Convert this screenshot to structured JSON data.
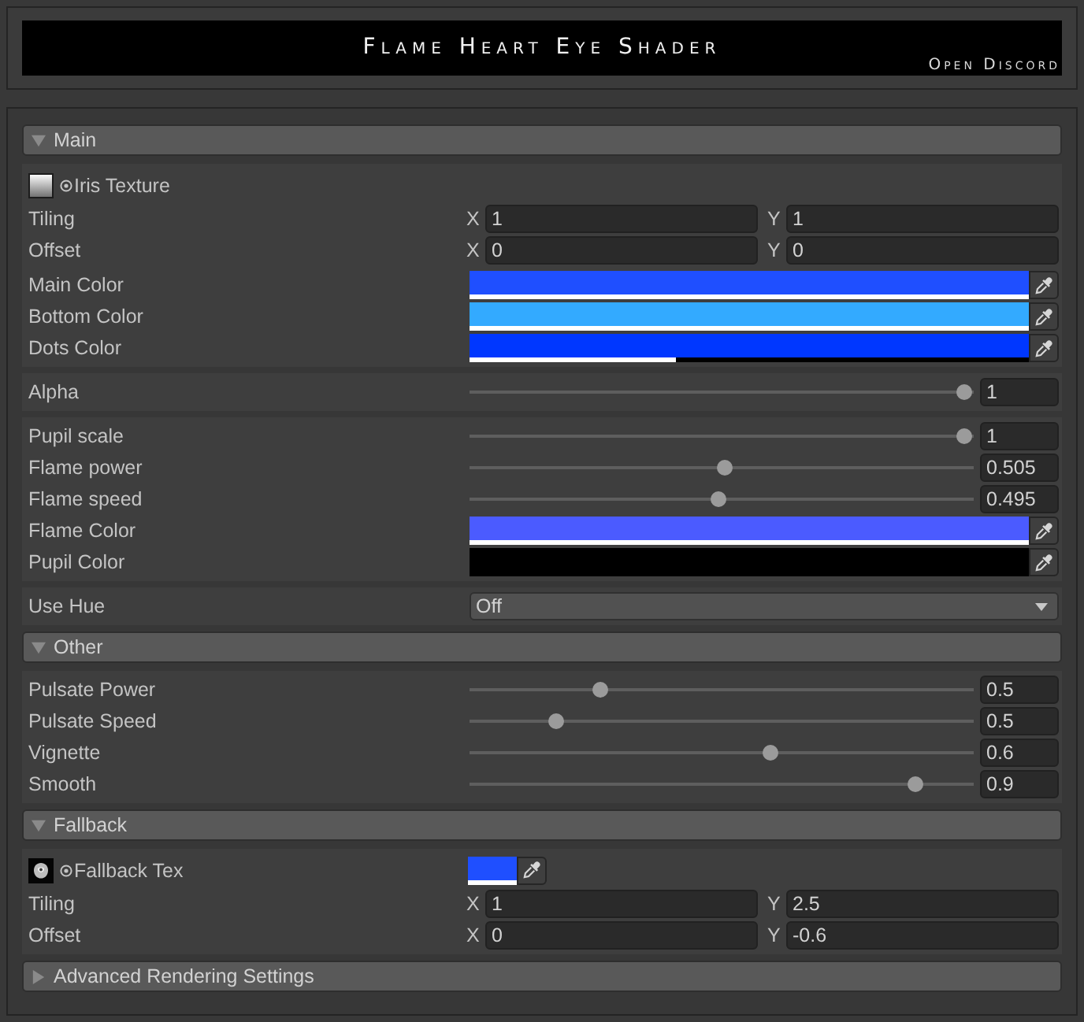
{
  "header": {
    "title": "Flame Heart Eye Shader",
    "link": "Open Discord"
  },
  "sections": [
    {
      "title": "Main",
      "expanded": true,
      "groups": [
        {
          "rows": [
            {
              "kind": "texture",
              "label": "Iris Texture",
              "thumbnail": {
                "kind": "gradient"
              }
            },
            {
              "kind": "vector",
              "label": "Tiling",
              "fields": [
                {
                  "axis": "X",
                  "value": "1"
                },
                {
                  "axis": "Y",
                  "value": "1"
                }
              ]
            },
            {
              "kind": "vector",
              "label": "Offset",
              "fields": [
                {
                  "axis": "X",
                  "value": "0"
                },
                {
                  "axis": "Y",
                  "value": "0"
                }
              ]
            },
            {
              "kind": "color",
              "label": "Main Color",
              "color": "#1f4fff",
              "level": 1
            },
            {
              "kind": "color",
              "label": "Bottom Color",
              "color": "#33aaff",
              "level": 1
            },
            {
              "kind": "color",
              "label": "Dots Color",
              "color": "#0037ff",
              "level": 0.37
            }
          ]
        },
        {
          "rows": [
            {
              "kind": "slider",
              "label": "Alpha",
              "level": 1,
              "value": "1"
            }
          ]
        },
        {
          "rows": [
            {
              "kind": "slider",
              "label": "Pupil scale",
              "level": 1,
              "value": "1"
            },
            {
              "kind": "slider",
              "label": "Flame power",
              "level": 0.505,
              "value": "0.505"
            },
            {
              "kind": "slider",
              "label": "Flame speed",
              "level": 0.495,
              "value": "0.495"
            },
            {
              "kind": "color",
              "label": "Flame Color",
              "color": "#4b5bff",
              "level": 1
            },
            {
              "kind": "color",
              "label": "Pupil Color",
              "color": "#000000"
            }
          ]
        },
        {
          "rows": [
            {
              "kind": "dropdown",
              "label": "Use Hue",
              "value": "Off"
            }
          ]
        }
      ]
    },
    {
      "title": "Other",
      "expanded": true,
      "groups": [
        {
          "rows": [
            {
              "kind": "slider",
              "label": "Pulsate Power",
              "level": 0.25,
              "value": "0.5"
            },
            {
              "kind": "slider",
              "label": "Pulsate Speed",
              "level": 0.16,
              "value": "0.5"
            },
            {
              "kind": "slider",
              "label": "Vignette",
              "level": 0.6,
              "value": "0.6"
            },
            {
              "kind": "slider",
              "label": "Smooth",
              "level": 0.9,
              "value": "0.9"
            }
          ]
        }
      ]
    },
    {
      "title": "Fallback",
      "expanded": true,
      "groups": [
        {
          "rows": [
            {
              "kind": "texture",
              "label": "Fallback Tex",
              "thumbnail": {
                "kind": "blob"
              },
              "color": "#1f4fff",
              "level": 1
            },
            {
              "kind": "vector",
              "label": "Tiling",
              "fields": [
                {
                  "axis": "X",
                  "value": "1"
                },
                {
                  "axis": "Y",
                  "value": "2.5"
                }
              ]
            },
            {
              "kind": "vector",
              "label": "Offset",
              "fields": [
                {
                  "axis": "X",
                  "value": "0"
                },
                {
                  "axis": "Y",
                  "value": "-0.6"
                }
              ]
            }
          ]
        }
      ]
    },
    {
      "title": "Advanced Rendering Settings",
      "expanded": false
    }
  ]
}
